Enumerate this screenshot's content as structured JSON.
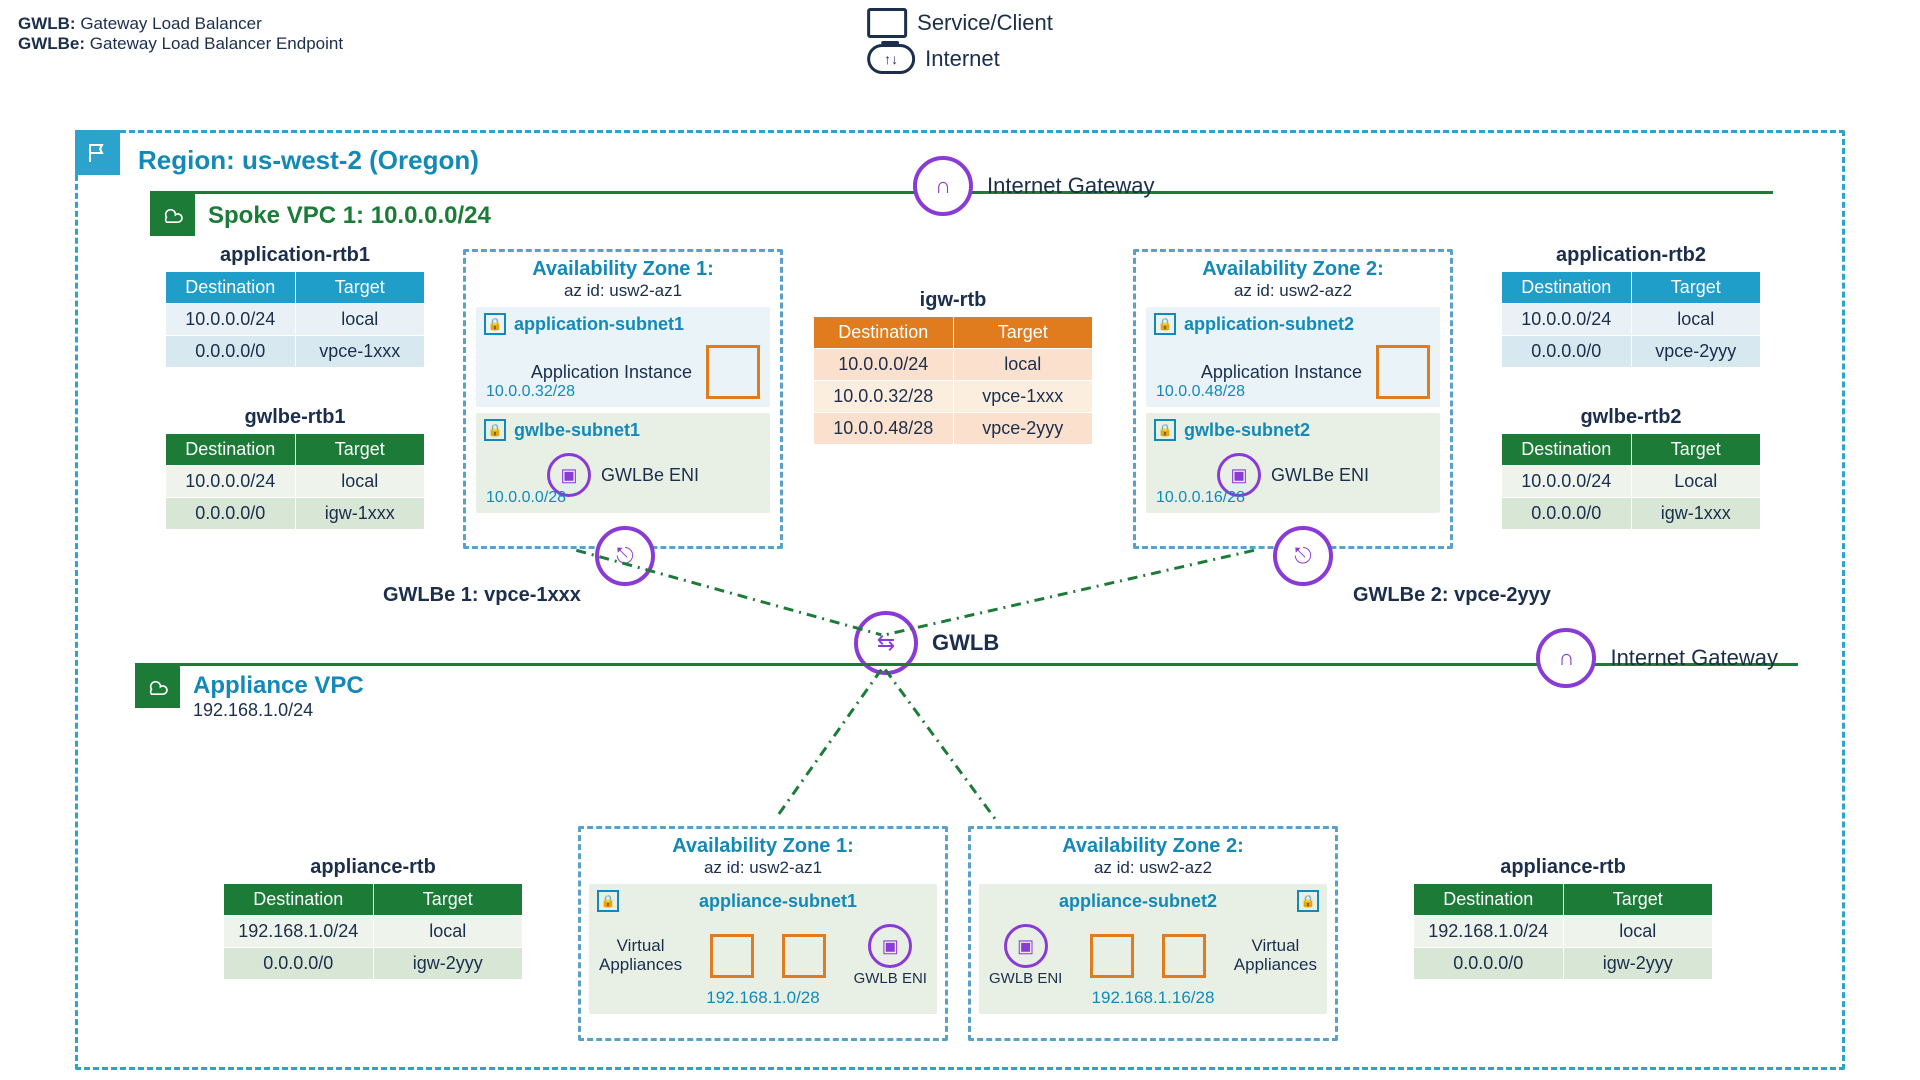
{
  "glossary": {
    "gwlb_key": "GWLB:",
    "gwlb_val": "Gateway Load Balancer",
    "gwlbe_key": "GWLBe:",
    "gwlbe_val": "Gateway Load Balancer Endpoint"
  },
  "top": {
    "service_client": "Service/Client",
    "internet": "Internet"
  },
  "region": {
    "title": "Region: us-west-2 (Oregon)"
  },
  "spoke_vpc": {
    "title": "Spoke VPC 1: 10.0.0.0/24",
    "igw_label": "Internet Gateway",
    "app_rtb1": {
      "title": "application-rtb1",
      "cols": [
        "Destination",
        "Target"
      ],
      "rows": [
        [
          "10.0.0.0/24",
          "local"
        ],
        [
          "0.0.0.0/0",
          "vpce-1xxx"
        ]
      ]
    },
    "app_rtb2": {
      "title": "application-rtb2",
      "cols": [
        "Destination",
        "Target"
      ],
      "rows": [
        [
          "10.0.0.0/24",
          "local"
        ],
        [
          "0.0.0.0/0",
          "vpce-2yyy"
        ]
      ]
    },
    "gwlbe_rtb1": {
      "title": "gwlbe-rtb1",
      "cols": [
        "Destination",
        "Target"
      ],
      "rows": [
        [
          "10.0.0.0/24",
          "local"
        ],
        [
          "0.0.0.0/0",
          "igw-1xxx"
        ]
      ]
    },
    "gwlbe_rtb2": {
      "title": "gwlbe-rtb2",
      "cols": [
        "Destination",
        "Target"
      ],
      "rows": [
        [
          "10.0.0.0/24",
          "Local"
        ],
        [
          "0.0.0.0/0",
          "igw-1xxx"
        ]
      ]
    },
    "az1": {
      "title": "Availability Zone 1:",
      "sub": "az id: usw2-az1",
      "app_subnet": {
        "name": "application-subnet1",
        "instance": "Application Instance",
        "cidr": "10.0.0.32/28"
      },
      "gwlbe_subnet": {
        "name": "gwlbe-subnet1",
        "eni": "GWLBe ENI",
        "cidr": "10.0.0.0/28"
      }
    },
    "az2": {
      "title": "Availability Zone 2:",
      "sub": "az id: usw2-az2",
      "app_subnet": {
        "name": "application-subnet2",
        "instance": "Application Instance",
        "cidr": "10.0.0.48/28"
      },
      "gwlbe_subnet": {
        "name": "gwlbe-subnet2",
        "eni": "GWLBe ENI",
        "cidr": "10.0.0.16/28"
      }
    },
    "igw_rtb": {
      "title": "igw-rtb",
      "cols": [
        "Destination",
        "Target"
      ],
      "rows": [
        [
          "10.0.0.0/24",
          "local"
        ],
        [
          "10.0.0.32/28",
          "vpce-1xxx"
        ],
        [
          "10.0.0.48/28",
          "vpce-2yyy"
        ]
      ]
    },
    "gwlbe1_cap": "GWLBe 1: vpce-1xxx",
    "gwlbe2_cap": "GWLBe 2: vpce-2yyy"
  },
  "gwlb_center": "GWLB",
  "appliance_vpc": {
    "title": "Appliance VPC",
    "cidr": "192.168.1.0/24",
    "igw_label": "Internet Gateway",
    "rtb_left": {
      "title": "appliance-rtb",
      "cols": [
        "Destination",
        "Target"
      ],
      "rows": [
        [
          "192.168.1.0/24",
          "local"
        ],
        [
          "0.0.0.0/0",
          "igw-2yyy"
        ]
      ]
    },
    "rtb_right": {
      "title": "appliance-rtb",
      "cols": [
        "Destination",
        "Target"
      ],
      "rows": [
        [
          "192.168.1.0/24",
          "local"
        ],
        [
          "0.0.0.0/0",
          "igw-2yyy"
        ]
      ]
    },
    "az1": {
      "title": "Availability Zone 1:",
      "sub": "az id: usw2-az1",
      "subnet": {
        "name": "appliance-subnet1",
        "va": "Virtual\nAppliances",
        "eni": "GWLB ENI",
        "cidr": "192.168.1.0/28"
      }
    },
    "az2": {
      "title": "Availability Zone 2:",
      "sub": "az id: usw2-az2",
      "subnet": {
        "name": "appliance-subnet2",
        "va": "Virtual\nAppliances",
        "eni": "GWLB ENI",
        "cidr": "192.168.1.16/28"
      }
    }
  }
}
